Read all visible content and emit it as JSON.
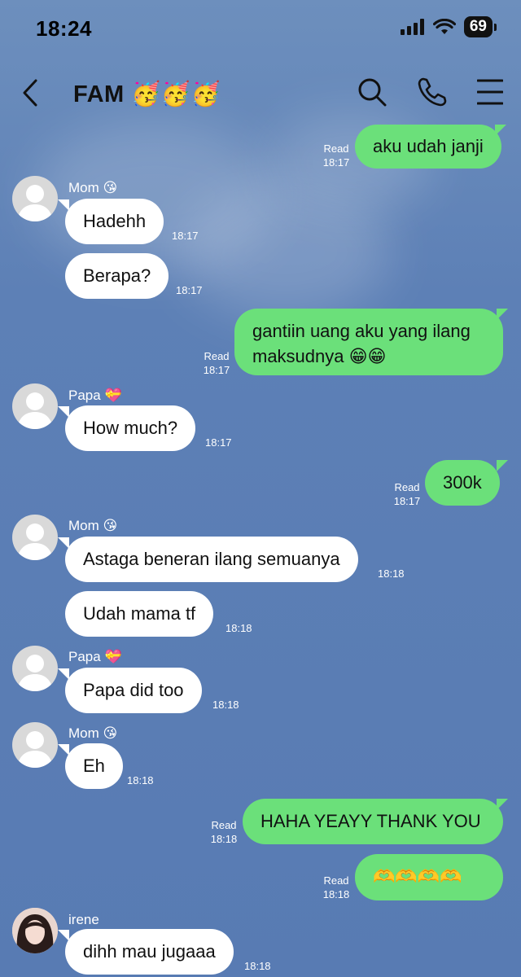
{
  "status": {
    "time": "18:24",
    "battery": "69"
  },
  "header": {
    "title": "FAM",
    "title_emoji": "🥳🥳🥳"
  },
  "messages": [
    {
      "text": "aku udah janji",
      "read": "Read",
      "time": "18:17"
    },
    {
      "sender": "Mom",
      "sender_emoji": "😘",
      "text": "Hadehh",
      "time": "18:17"
    },
    {
      "text": "Berapa?",
      "time": "18:17"
    },
    {
      "text_line1": "gantiin uang aku yang ilang",
      "text_line2": "maksudnya 😁😁",
      "read": "Read",
      "time": "18:17"
    },
    {
      "sender": "Papa",
      "sender_emoji": "💝",
      "text": "How much?",
      "time": "18:17"
    },
    {
      "text": "300k",
      "read": "Read",
      "time": "18:17"
    },
    {
      "sender": "Mom",
      "sender_emoji": "😘",
      "text": "Astaga beneran ilang semuanya",
      "time": "18:18"
    },
    {
      "text": "Udah mama tf",
      "time": "18:18"
    },
    {
      "sender": "Papa",
      "sender_emoji": "💝",
      "text": "Papa did too",
      "time": "18:18"
    },
    {
      "sender": "Mom",
      "sender_emoji": "😘",
      "text": "Eh",
      "time": "18:18"
    },
    {
      "text": "HAHA YEAYY THANK YOU",
      "read": "Read",
      "time": "18:18"
    },
    {
      "text": "🫶🫶🫶🫶",
      "read": "Read",
      "time": "18:18"
    },
    {
      "sender": "irene",
      "text": "dihh mau jugaaa",
      "time": "18:18"
    }
  ]
}
